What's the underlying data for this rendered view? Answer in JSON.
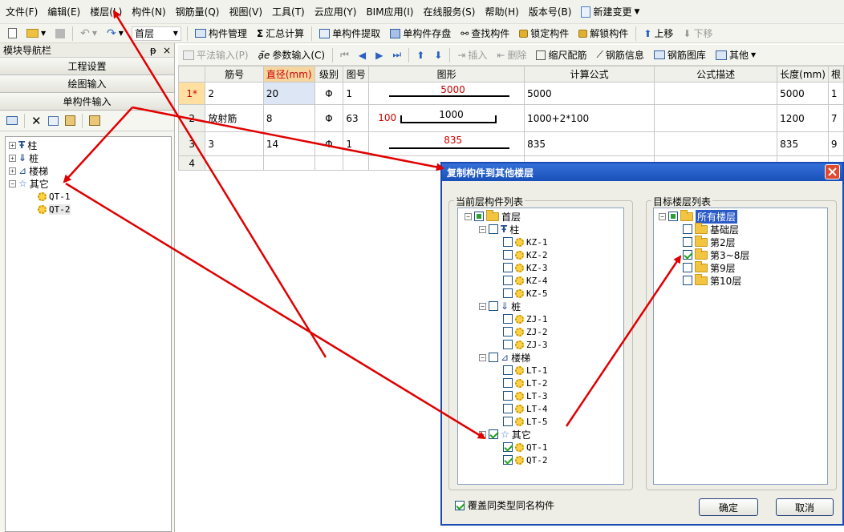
{
  "menu": [
    "文件(F)",
    "编辑(E)",
    "楼层(L)",
    "构件(N)",
    "钢筋量(Q)",
    "视图(V)",
    "工具(T)",
    "云应用(Y)",
    "BIM应用(I)",
    "在线服务(S)",
    "帮助(H)",
    "版本号(B)"
  ],
  "menu_extra": "新建变更",
  "toolbar1": {
    "floor": "首层",
    "buttons": [
      "构件管理",
      "汇总计算",
      "单构件提取",
      "单构件存盘",
      "查找构件",
      "锁定构件",
      "解锁构件",
      "上移",
      "下移"
    ]
  },
  "nav": {
    "title": "模块导航栏",
    "pin": "ᵽ",
    "close": "×",
    "sections": [
      "工程设置",
      "绘图输入",
      "单构件输入"
    ],
    "tree": [
      {
        "label": "柱",
        "expand": "+"
      },
      {
        "label": "桩",
        "expand": "+"
      },
      {
        "label": "楼梯",
        "expand": "+"
      },
      {
        "label": "其它",
        "expand": "−"
      },
      {
        "label": "QT-1"
      },
      {
        "label": "QT-2"
      }
    ]
  },
  "toolbar2": [
    "平法输入(P)",
    "参数输入(C)",
    "插入",
    "删除",
    "缩尺配筋",
    "钢筋信息",
    "钢筋图库",
    "其他"
  ],
  "grid": {
    "headers": [
      "",
      "筋号",
      "直径(mm)",
      "级别",
      "图号",
      "图形",
      "计算公式",
      "公式描述",
      "长度(mm)",
      "根"
    ],
    "rows": [
      {
        "num": "1*",
        "bar": "2",
        "dia": "20",
        "grade": "Φ",
        "fig": "1",
        "shape_left": "",
        "shape_main": "5000",
        "formula": "5000",
        "desc": "",
        "length": "5000",
        "count": "1"
      },
      {
        "num": "2",
        "bar": "放射筋",
        "dia": "8",
        "grade": "Φ",
        "fig": "63",
        "shape_left": "100",
        "shape_main": "1000",
        "formula": "1000+2*100",
        "desc": "",
        "length": "1200",
        "count": "7"
      },
      {
        "num": "3",
        "bar": "3",
        "dia": "14",
        "grade": "Φ",
        "fig": "1",
        "shape_left": "",
        "shape_main": "835",
        "formula": "835",
        "desc": "",
        "length": "835",
        "count": "9"
      },
      {
        "num": "4",
        "bar": "",
        "dia": "",
        "grade": "",
        "fig": "",
        "shape_left": "",
        "shape_main": "",
        "formula": "",
        "desc": "",
        "length": "",
        "count": ""
      }
    ]
  },
  "dialog": {
    "title": "复制构件到其他楼层",
    "left_label": "当前层构件列表",
    "right_label": "目标楼层列表",
    "left_tree": [
      {
        "label": "首层",
        "level": 0,
        "expand": "−",
        "check": "part",
        "folder": true
      },
      {
        "label": "柱",
        "level": 1,
        "expand": "−",
        "check": "off",
        "icon": "column"
      },
      {
        "label": "KZ-1",
        "level": 2,
        "check": "off"
      },
      {
        "label": "KZ-2",
        "level": 2,
        "check": "off"
      },
      {
        "label": "KZ-3",
        "level": 2,
        "check": "off"
      },
      {
        "label": "KZ-4",
        "level": 2,
        "check": "off"
      },
      {
        "label": "KZ-5",
        "level": 2,
        "check": "off"
      },
      {
        "label": "桩",
        "level": 1,
        "expand": "−",
        "check": "off",
        "icon": "pile"
      },
      {
        "label": "ZJ-1",
        "level": 2,
        "check": "off"
      },
      {
        "label": "ZJ-2",
        "level": 2,
        "check": "off"
      },
      {
        "label": "ZJ-3",
        "level": 2,
        "check": "off"
      },
      {
        "label": "楼梯",
        "level": 1,
        "expand": "−",
        "check": "off",
        "icon": "stair"
      },
      {
        "label": "LT-1",
        "level": 2,
        "check": "off"
      },
      {
        "label": "LT-2",
        "level": 2,
        "check": "off"
      },
      {
        "label": "LT-3",
        "level": 2,
        "check": "off"
      },
      {
        "label": "LT-4",
        "level": 2,
        "check": "off"
      },
      {
        "label": "LT-5",
        "level": 2,
        "check": "off"
      },
      {
        "label": "其它",
        "level": 1,
        "expand": "−",
        "check": "on",
        "icon": "star"
      },
      {
        "label": "QT-1",
        "level": 2,
        "check": "on"
      },
      {
        "label": "QT-2",
        "level": 2,
        "check": "on"
      }
    ],
    "right_tree": [
      {
        "label": "所有楼层",
        "level": 0,
        "expand": "−",
        "check": "part",
        "selected": true
      },
      {
        "label": "基础层",
        "level": 1,
        "check": "off"
      },
      {
        "label": "第2层",
        "level": 1,
        "check": "off"
      },
      {
        "label": "第3~8层",
        "level": 1,
        "check": "on"
      },
      {
        "label": "第9层",
        "level": 1,
        "check": "off"
      },
      {
        "label": "第10层",
        "level": 1,
        "check": "off"
      }
    ],
    "override_label": "覆盖同类型同名构件",
    "ok": "确定",
    "cancel": "取消"
  },
  "colors": {
    "arrow": "#e00000",
    "title_bar": "#1c4ab4",
    "highlight": "#f6d6a0"
  }
}
